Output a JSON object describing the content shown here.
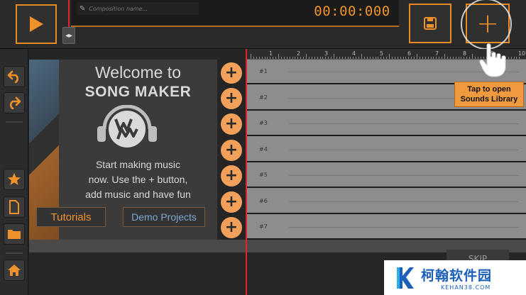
{
  "header": {
    "composition_placeholder": "Composition name...",
    "timer": "00:00:000",
    "play_icon": "play-icon",
    "save_icon": "save-icon",
    "add_icon": "plus-icon"
  },
  "left_toolbar": {
    "items": [
      {
        "icon": "undo-icon"
      },
      {
        "icon": "redo-icon"
      },
      {
        "icon": "star-icon"
      },
      {
        "icon": "new-file-icon"
      },
      {
        "icon": "folder-icon"
      },
      {
        "icon": "home-icon"
      }
    ]
  },
  "ruler": {
    "numbers": [
      "1",
      "2",
      "3",
      "4",
      "5",
      "6",
      "7",
      "8",
      "9",
      "10"
    ]
  },
  "welcome": {
    "title": "Welcome to",
    "subtitle": "SONG MAKER",
    "body_line1": "Start making music",
    "body_line2": "now. Use the + button,",
    "body_line3": "add music and have fun",
    "tutorials_label": "Tutorials",
    "demo_label": "Demo Projects"
  },
  "tracks": [
    {
      "label": "#1"
    },
    {
      "label": "#2"
    },
    {
      "label": "#3"
    },
    {
      "label": "#4"
    },
    {
      "label": "#5"
    },
    {
      "label": "#6"
    },
    {
      "label": "#7"
    }
  ],
  "tooltip": {
    "line1": "Tap to open",
    "line2": "Sounds Library"
  },
  "skip_label": "SKIP",
  "watermark": {
    "cn": "柯翰软件园",
    "en": "KEHAN38.COM"
  },
  "colors": {
    "accent": "#e88a25",
    "playhead": "#e2242e",
    "track_bg": "#8d8d8d",
    "demo_text": "#7fa8d3"
  }
}
